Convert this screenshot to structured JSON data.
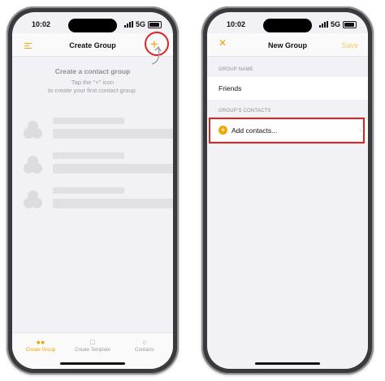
{
  "left": {
    "status": {
      "time": "10:02",
      "network": "5G"
    },
    "nav": {
      "title": "Create Group",
      "add_glyph": "+"
    },
    "empty": {
      "title": "Create a contact group",
      "subtitle_line1": "Tap the \"+\" icon",
      "subtitle_line2": "to create your first contact group."
    },
    "tabs": [
      {
        "label": "Create Group",
        "icon": "group-icon",
        "active": true
      },
      {
        "label": "Create Template",
        "icon": "document-icon",
        "active": false
      },
      {
        "label": "Contacts",
        "icon": "person-icon",
        "active": false
      }
    ]
  },
  "right": {
    "status": {
      "time": "10:02",
      "network": "5G"
    },
    "nav": {
      "title": "New Group",
      "cancel_glyph": "✕",
      "save_label": "Save"
    },
    "group_name_label": "GROUP NAME",
    "group_name_value": "Friends",
    "contacts_label": "GROUP'S CONTACTS",
    "add_contacts_label": "Add contacts...",
    "add_glyph": "+",
    "chevron_glyph": "›"
  },
  "colors": {
    "accent": "#f0a500",
    "highlight": "#e0231d"
  }
}
